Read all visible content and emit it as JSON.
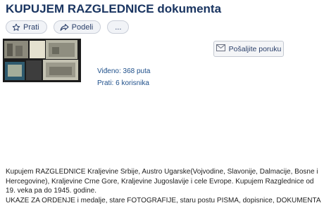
{
  "listing": {
    "title": "KUPUJEM RAZGLEDNICE dokumenta",
    "follow_label": "Prati",
    "share_label": "Podeli",
    "more_label": "...",
    "send_message_label": "Pošaljite poruku",
    "views_text": "Viđeno: 368 puta",
    "followers_text": "Prati: 6 korisnika",
    "description_line1": "Kupujem RAZGLEDNICE Kraljevine Srbije, Austro Ugarske(Vojvodine, Slavonije, Dalmacije, Bosne i Hercegovine), Kraljevine Crne Gore, Kraljevine Jugoslavije i cele Evrope. Kupujem Razglednice od 19. veka pa do 1945. godine.",
    "description_line2": "UKAZE ZA ORDENJE i medalje, stare FOTOGRAFIJE, staru postu PISMA, dopisnice, DOKUMENTA"
  },
  "icons": {
    "follow": "star-icon",
    "share": "share-arrow-icon",
    "message": "envelope-icon"
  },
  "colors": {
    "title": "#1a3561",
    "link": "#1e4f8a",
    "pill_bg": "#f1f3f7"
  }
}
